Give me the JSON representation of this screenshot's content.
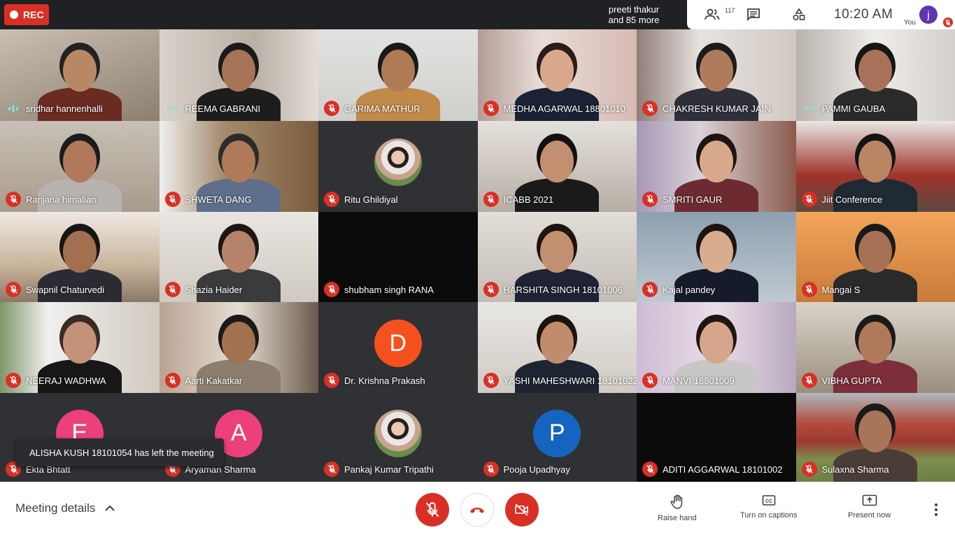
{
  "top_bar": {
    "rec_label": "REC",
    "presenter_line1": "preeti thakur",
    "presenter_line2": "and 85 more",
    "participant_count": "117",
    "time": "10:20  AM",
    "self_initial": "j",
    "self_label": "You"
  },
  "colors": {
    "accent_red": "#d93025",
    "speaking_teal": "#81e6d9",
    "tile_bg": "#3c4043",
    "avatar_orange": "#f4511e",
    "avatar_pink": "#ec407a",
    "avatar_blue": "#1565c0",
    "self_avatar": "#5e35b1"
  },
  "tiles": [
    {
      "name": "sridhar hannenhalli",
      "status": "speaking",
      "icon": "speaking-icon"
    },
    {
      "name": "REEMA GABRANI",
      "status": "unmuted",
      "icon": "dots-icon"
    },
    {
      "name": "GARIMA MATHUR",
      "status": "muted",
      "icon": "mic-off-icon"
    },
    {
      "name": "MEDHA AGARWAL 18801010",
      "status": "muted",
      "icon": "mic-off-icon"
    },
    {
      "name": "CHAKRESH KUMAR JAIN",
      "status": "muted",
      "icon": "mic-off-icon"
    },
    {
      "name": "PAMMI GAUBA",
      "status": "unmuted",
      "icon": "dots-icon"
    },
    {
      "name": "Ranjana himalian",
      "status": "muted",
      "icon": "mic-off-icon"
    },
    {
      "name": "SHWETA DANG",
      "status": "muted",
      "icon": "mic-off-icon"
    },
    {
      "name": "Ritu Ghildiyal",
      "status": "muted",
      "icon": "mic-off-icon"
    },
    {
      "name": "ICABB 2021",
      "status": "muted",
      "icon": "mic-off-icon"
    },
    {
      "name": "SMRITI GAUR",
      "status": "muted",
      "icon": "mic-off-icon"
    },
    {
      "name": "Jiit Conference",
      "status": "muted",
      "icon": "mic-off-icon"
    },
    {
      "name": "Swapnil Chaturvedi",
      "status": "muted",
      "icon": "mic-off-icon"
    },
    {
      "name": "Shazia Haider",
      "status": "muted",
      "icon": "mic-off-icon"
    },
    {
      "name": "shubham singh RANA",
      "status": "muted",
      "icon": "mic-off-icon"
    },
    {
      "name": "HARSHITA SINGH 18101006",
      "status": "muted",
      "icon": "mic-off-icon"
    },
    {
      "name": "Kajal pandey",
      "status": "muted",
      "icon": "mic-off-icon"
    },
    {
      "name": "Mangai S",
      "status": "muted",
      "icon": "mic-off-icon"
    },
    {
      "name": "NEERAJ WADHWA",
      "status": "muted",
      "icon": "mic-off-icon"
    },
    {
      "name": "Aarti Kakatkar",
      "status": "muted",
      "icon": "mic-off-icon"
    },
    {
      "name": "Dr. Krishna Prakash",
      "status": "muted",
      "icon": "mic-off-icon",
      "avatar_letter": "D"
    },
    {
      "name": "YASHI MAHESHWARI 18101022",
      "status": "muted",
      "icon": "mic-off-icon"
    },
    {
      "name": "MANVI 18801009",
      "status": "muted",
      "icon": "mic-off-icon"
    },
    {
      "name": "VIBHA GUPTA",
      "status": "muted",
      "icon": "mic-off-icon"
    },
    {
      "name": "Ekta Bhtatt",
      "status": "muted",
      "icon": "mic-off-icon",
      "avatar_letter": "E"
    },
    {
      "name": "Aryaman Sharma",
      "status": "muted",
      "icon": "mic-off-icon",
      "avatar_letter": "A"
    },
    {
      "name": "Pankaj Kumar Tripathi",
      "status": "muted",
      "icon": "mic-off-icon"
    },
    {
      "name": "Pooja Upadhyay",
      "status": "muted",
      "icon": "mic-off-icon",
      "avatar_letter": "P"
    },
    {
      "name": "ADITI AGGARWAL 18101002",
      "status": "muted",
      "icon": "mic-off-icon"
    },
    {
      "name": "Sulaxna Sharma",
      "status": "muted",
      "icon": "mic-off-icon"
    }
  ],
  "toast": "ALISHA KUSH 18101054 has left the meeting",
  "bottom_bar": {
    "meeting_details": "Meeting details",
    "raise_hand": "Raise hand",
    "captions": "Turn on captions",
    "present": "Present now"
  }
}
